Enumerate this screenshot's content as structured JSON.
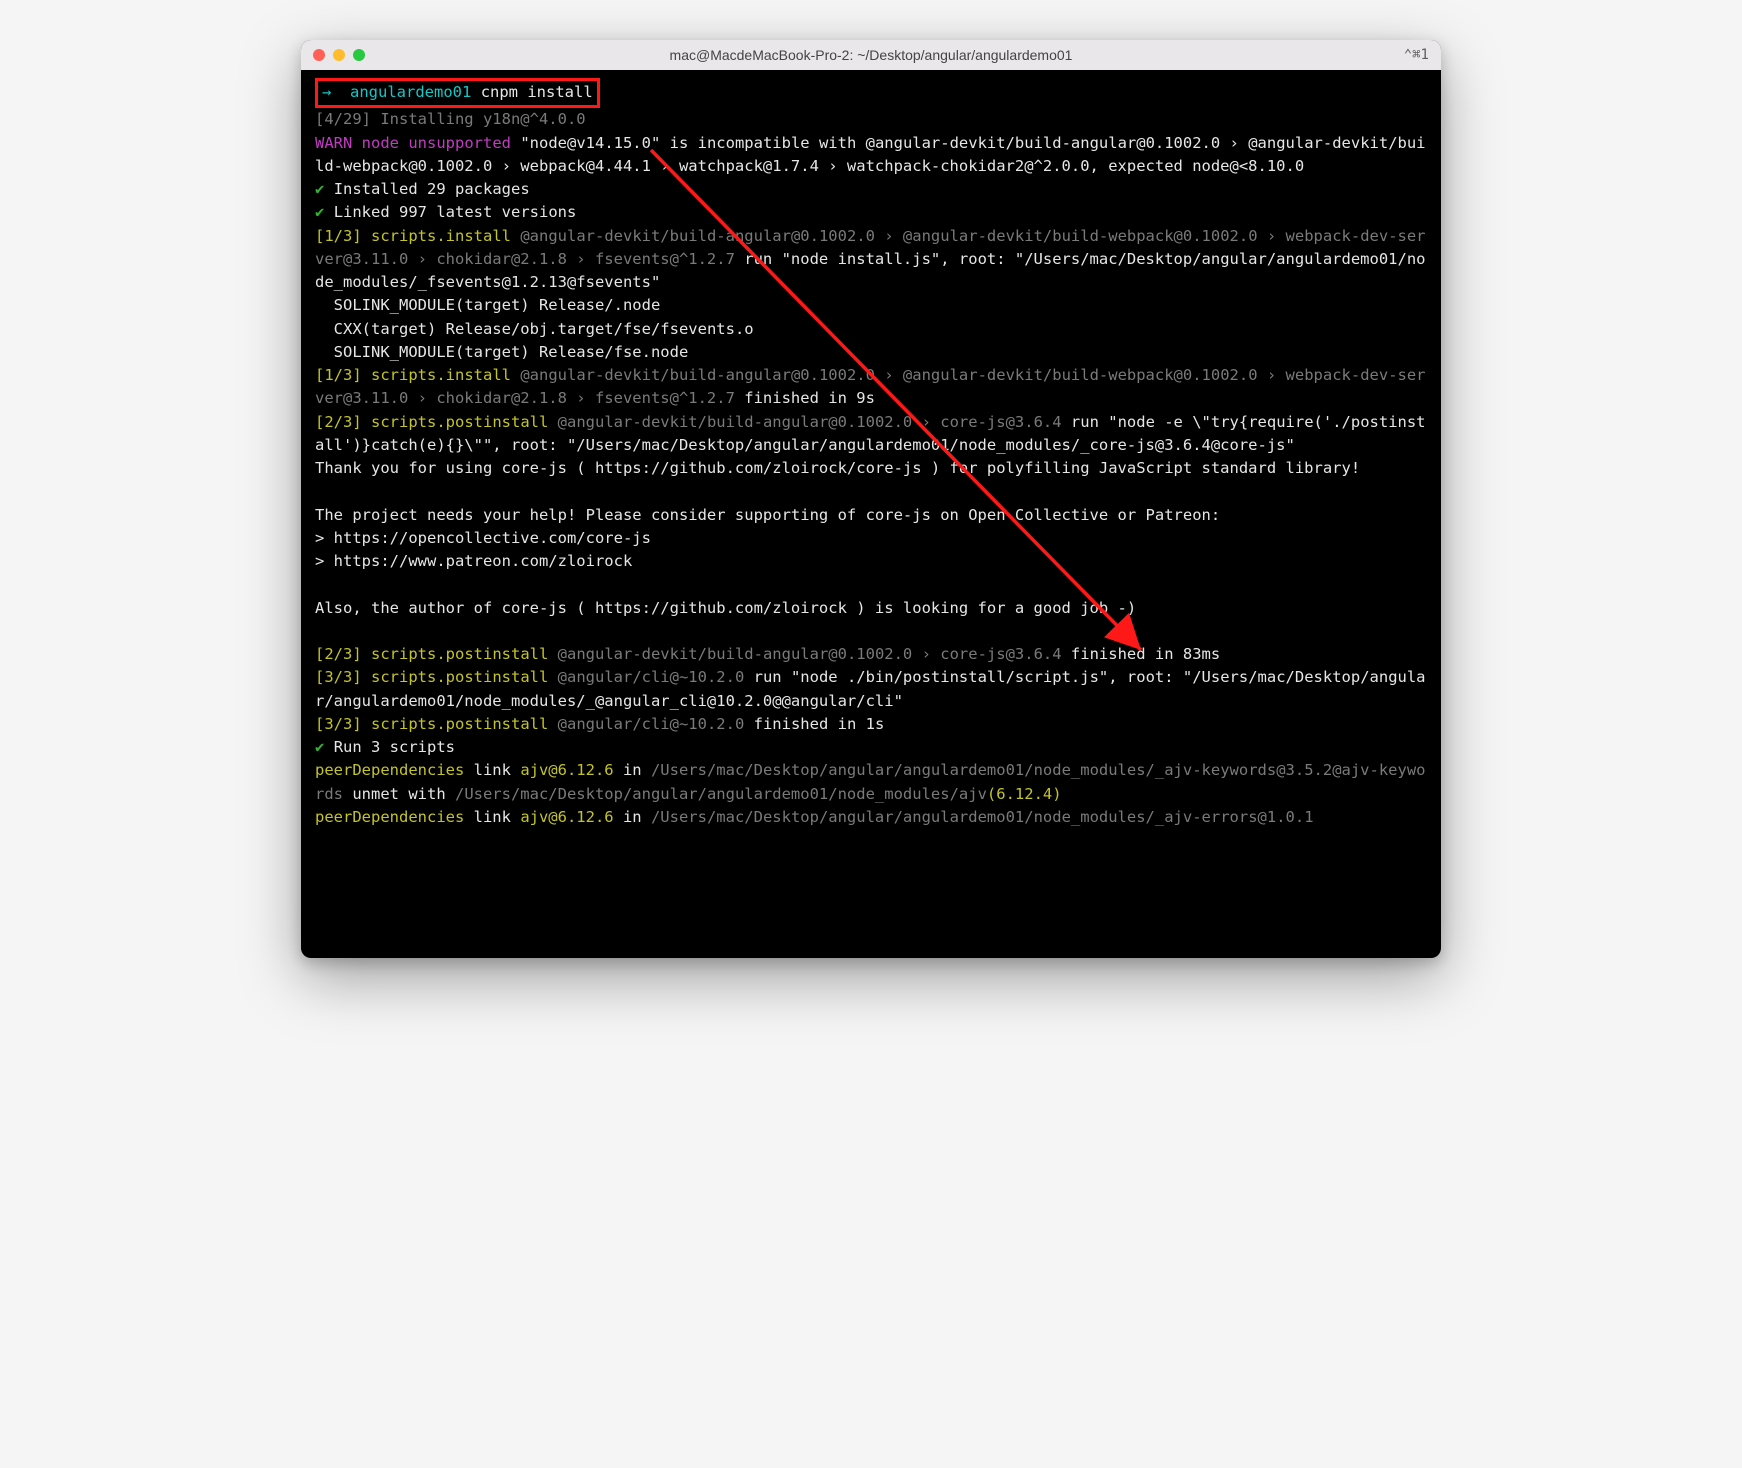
{
  "titlebar": {
    "title": "mac@MacdeMacBook-Pro-2: ~/Desktop/angular/angulardemo01",
    "shortcut": "⌃⌘1"
  },
  "prompt": {
    "arrow": "→",
    "dir": "angulardemo01",
    "cmd": "cnpm install"
  },
  "lines": {
    "installing": "[4/29] Installing y18n@^4.0.0",
    "warn_prefix": "WARN",
    "warn_label": "node unsupported",
    "warn_quote": "\"node@v14.15.0\"",
    "warn_tail": " is incompatible with @angular-devkit/build-angular@0.1002.0 › @angular-devkit/build-webpack@0.1002.0 › webpack@4.44.1 › watchpack@1.7.4 › watchpack-chokidar2@^2.0.0, expected node@<8.10.0",
    "check1": "Installed 29 packages",
    "check2": "Linked 997 latest versions",
    "s1_tag": "[1/3]",
    "s1_label": "scripts.install",
    "s1_grey": " @angular-devkit/build-angular@0.1002.0 › @angular-devkit/build-webpack@0.1002.0 › webpack-dev-server@3.11.0 › chokidar@2.1.8 › fsevents@^1.2.7",
    "s1_white": " run \"node install.js\", root: \"/Users/mac/Desktop/angular/angulardemo01/node_modules/_fsevents@1.2.13@fsevents\"",
    "sol1": "  SOLINK_MODULE(target) Release/.node",
    "cxx": "  CXX(target) Release/obj.target/fse/fsevents.o",
    "sol2": "  SOLINK_MODULE(target) Release/fse.node",
    "s1b_grey": " @angular-devkit/build-angular@0.1002.0 › @angular-devkit/build-webpack@0.1002.0 › webpack-dev-server@3.11.0 › chokidar@2.1.8 › fsevents@^1.2.7",
    "s1b_white": " finished in 9s",
    "s2_tag": "[2/3]",
    "s2_label": "scripts.postinstall",
    "s2_grey": " @angular-devkit/build-angular@0.1002.0 › core-js@3.6.4",
    "s2_white": " run \"node -e \\\"try{require('./postinstall')}catch(e){}\\\"\", root: \"/Users/mac/Desktop/angular/angulardemo01/node_modules/_core-js@3.6.4@core-js\"",
    "thanks": "Thank you for using core-js ( https://github.com/zloirock/core-js ) for polyfilling JavaScript standard library!",
    "help": "The project needs your help! Please consider supporting of core-js on Open Collective or Patreon:",
    "link1": "> https://opencollective.com/core-js",
    "link2": "> https://www.patreon.com/zloirock",
    "also": "Also, the author of core-js ( https://github.com/zloirock ) is looking for a good job -)",
    "s2b_grey": " @angular-devkit/build-angular@0.1002.0 › core-js@3.6.4",
    "s2b_white": " finished in 83ms",
    "s3_tag": "[3/3]",
    "s3_label": "scripts.postinstall",
    "s3_grey": " @angular/cli@~10.2.0",
    "s3_white": " run \"node ./bin/postinstall/script.js\", root: \"/Users/mac/Desktop/angular/angulardemo01/node_modules/_@angular_cli@10.2.0@@angular/cli\"",
    "s3b_grey": " @angular/cli@~10.2.0",
    "s3b_white": " finished in 1s",
    "run3": "Run 3 scripts",
    "pd1_a": "peerDependencies",
    "pd1_b": " link ",
    "pd1_c": "ajv@6.12.6",
    "pd1_d": " in ",
    "pd1_e": "/Users/mac/Desktop/angular/angulardemo01/node_modules/_ajv-keywords@3.5.2@ajv-keywords",
    "pd1_f": " unmet with ",
    "pd1_g": "/Users/mac/Desktop/angular/angulardemo01/node_modules/ajv",
    "pd1_h": "(6.12.4)",
    "pd2_a": "peerDependencies",
    "pd2_b": " link ",
    "pd2_c": "ajv@6.12.6",
    "pd2_d": " in ",
    "pd2_e": "/Users/mac/Desktop/angular/angulardemo01/node_modules/_ajv-errors@1.0.1"
  }
}
